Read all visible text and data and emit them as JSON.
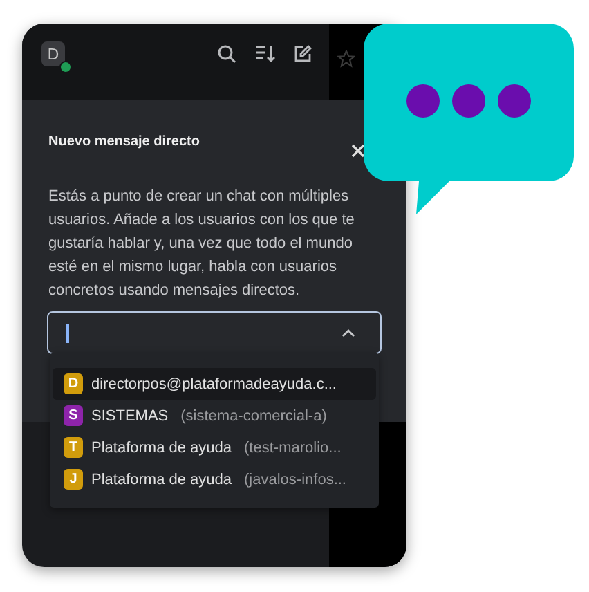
{
  "header": {
    "avatar": {
      "letter": "D",
      "online": true
    }
  },
  "dialog": {
    "title": "Nuevo mensaje directo",
    "description": "Estás a punto de crear un chat con múltiples usuarios. Añade a los usuarios con los que te gustaría hablar y, una vez que todo el mundo esté en el mismo lugar, habla con usuarios concretos usando mensajes directos.",
    "input": {
      "expanded": true
    }
  },
  "suggestions": [
    {
      "letter": "D",
      "color": "#d19c0c",
      "name": "directorpos@plataformadeayuda.c...",
      "selected": true
    },
    {
      "letter": "S",
      "color": "#8e24aa",
      "name": "SISTEMAS",
      "handle": "(sistema-comercial-a)",
      "selected": false
    },
    {
      "letter": "T",
      "color": "#d19c0c",
      "name": "Plataforma de ayuda",
      "handle": "(test-marolio...",
      "selected": false
    },
    {
      "letter": "J",
      "color": "#d19c0c",
      "name": "Plataforma de ayuda",
      "handle": "(javalos-infos...",
      "selected": false
    }
  ]
}
